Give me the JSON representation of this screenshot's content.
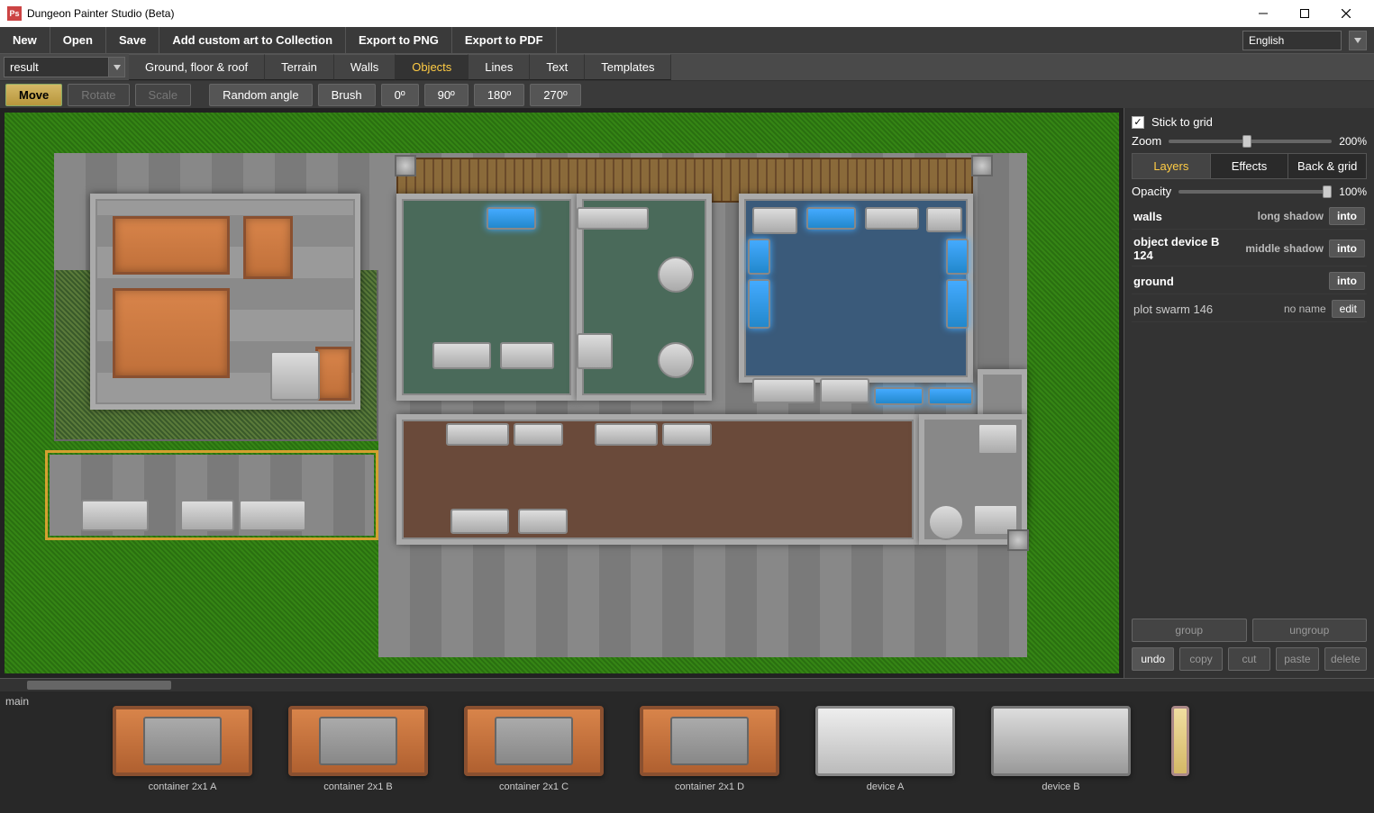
{
  "app": {
    "title": "Dungeon Painter Studio (Beta)",
    "icon_text": "Ps"
  },
  "menu": {
    "new": "New",
    "open": "Open",
    "save": "Save",
    "add_custom": "Add custom art to Collection",
    "export_png": "Export to PNG",
    "export_pdf": "Export to PDF",
    "language": "English"
  },
  "toolbar2": {
    "dropdown_value": "result",
    "tabs": {
      "ground": "Ground, floor & roof",
      "terrain": "Terrain",
      "walls": "Walls",
      "objects": "Objects",
      "lines": "Lines",
      "text": "Text",
      "templates": "Templates"
    }
  },
  "toolbar3": {
    "move": "Move",
    "rotate": "Rotate",
    "scale": "Scale",
    "random_angle": "Random angle",
    "brush": "Brush",
    "a0": "0º",
    "a90": "90º",
    "a180": "180º",
    "a270": "270º"
  },
  "right_panel": {
    "stick_to_grid": "Stick to grid",
    "zoom_label": "Zoom",
    "zoom_value": "200%",
    "tabs": {
      "layers": "Layers",
      "effects": "Effects",
      "back_grid": "Back & grid"
    },
    "opacity_label": "Opacity",
    "opacity_value": "100%",
    "layers": [
      {
        "name": "walls",
        "shadow": "long shadow",
        "btn": "into",
        "sel": true
      },
      {
        "name": "object device B 124",
        "shadow": "middle shadow",
        "btn": "into",
        "sel": true
      },
      {
        "name": "ground",
        "shadow": "",
        "btn": "into",
        "sel": true
      },
      {
        "name": "plot swarm 146",
        "shadow": "no name",
        "btn": "edit",
        "sel": false
      }
    ],
    "group": "group",
    "ungroup": "ungroup",
    "undo": "undo",
    "copy": "copy",
    "cut": "cut",
    "paste": "paste",
    "delete": "delete"
  },
  "bottom": {
    "category": "main",
    "assets": [
      {
        "name": "container 2x1 A",
        "type": "container"
      },
      {
        "name": "container 2x1 B",
        "type": "container"
      },
      {
        "name": "container 2x1 C",
        "type": "container"
      },
      {
        "name": "container 2x1 D",
        "type": "container"
      },
      {
        "name": "device A",
        "type": "device-a"
      },
      {
        "name": "device B",
        "type": "device-b"
      },
      {
        "name": "",
        "type": "device-c"
      }
    ]
  }
}
